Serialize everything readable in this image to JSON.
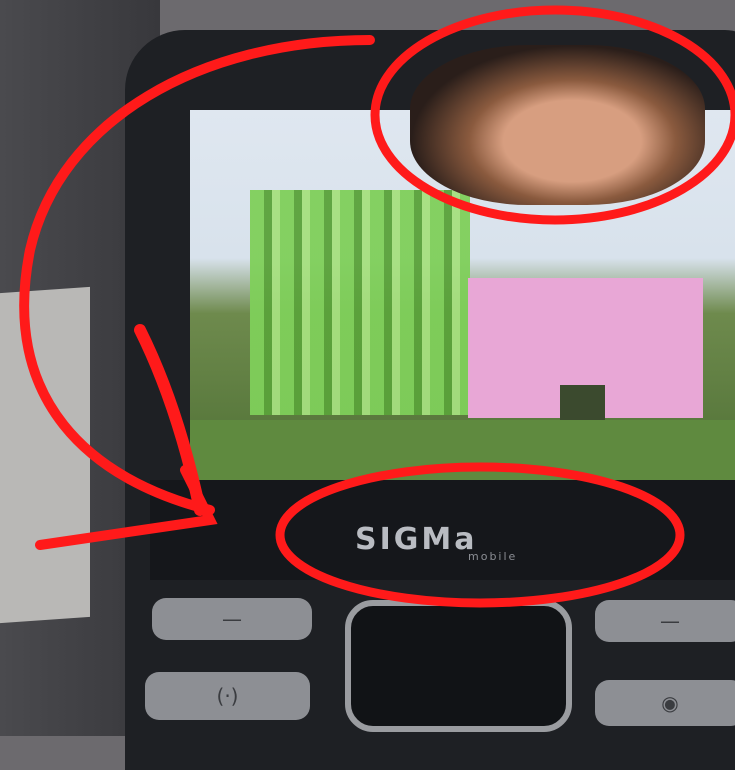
{
  "phone": {
    "brand_logo": "SIGMa",
    "brand_sub": "mobile"
  },
  "keys": [
    {
      "icon": "minus-icon",
      "glyph": "—"
    },
    {
      "icon": "minus-icon",
      "glyph": "—"
    },
    {
      "icon": "call-icon",
      "glyph": "(·)"
    },
    {
      "icon": "eye-icon",
      "glyph": "◉"
    }
  ],
  "colors": {
    "annotation": "#ff1a1a",
    "phone_body": "#1e2024",
    "green_figure": "#7fcf5a",
    "pink_figure": "#e8a7d6"
  }
}
